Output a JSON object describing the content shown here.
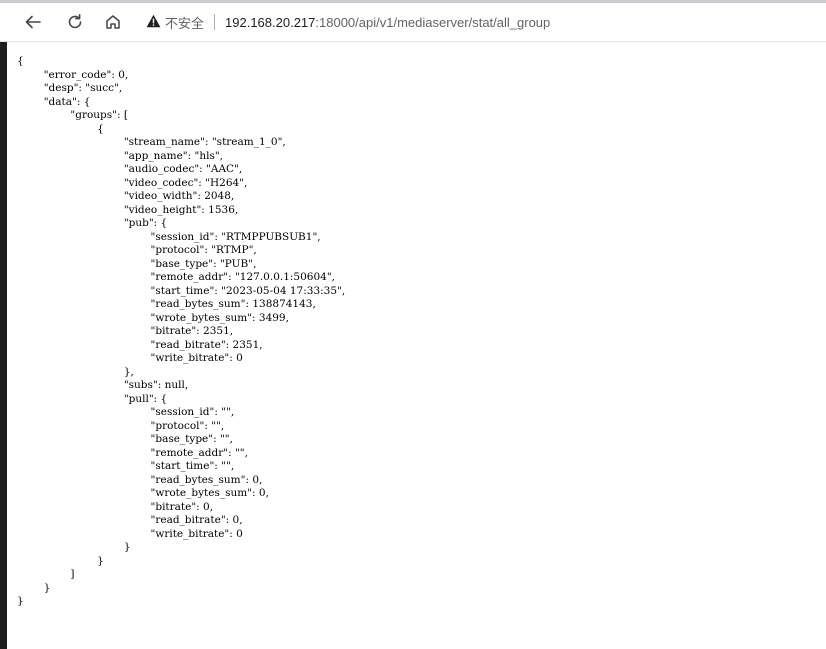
{
  "browser": {
    "security_label": "不安全",
    "url_host": "192.168.20.217",
    "url_rest": ":18000/api/v1/mediaserver/stat/all_group",
    "icons": {
      "back": "arrow-left-icon",
      "reload": "reload-icon",
      "home": "home-icon",
      "security": "warning-triangle-icon"
    }
  },
  "page": {
    "json_text": "{\n\t\"error_code\": 0,\n\t\"desp\": \"succ\",\n\t\"data\": {\n\t\t\"groups\": [\n\t\t\t{\n\t\t\t\t\"stream_name\": \"stream_1_0\",\n\t\t\t\t\"app_name\": \"hls\",\n\t\t\t\t\"audio_codec\": \"AAC\",\n\t\t\t\t\"video_codec\": \"H264\",\n\t\t\t\t\"video_width\": 2048,\n\t\t\t\t\"video_height\": 1536,\n\t\t\t\t\"pub\": {\n\t\t\t\t\t\"session_id\": \"RTMPPUBSUB1\",\n\t\t\t\t\t\"protocol\": \"RTMP\",\n\t\t\t\t\t\"base_type\": \"PUB\",\n\t\t\t\t\t\"remote_addr\": \"127.0.0.1:50604\",\n\t\t\t\t\t\"start_time\": \"2023-05-04 17:33:35\",\n\t\t\t\t\t\"read_bytes_sum\": 138874143,\n\t\t\t\t\t\"wrote_bytes_sum\": 3499,\n\t\t\t\t\t\"bitrate\": 2351,\n\t\t\t\t\t\"read_bitrate\": 2351,\n\t\t\t\t\t\"write_bitrate\": 0\n\t\t\t\t},\n\t\t\t\t\"subs\": null,\n\t\t\t\t\"pull\": {\n\t\t\t\t\t\"session_id\": \"\",\n\t\t\t\t\t\"protocol\": \"\",\n\t\t\t\t\t\"base_type\": \"\",\n\t\t\t\t\t\"remote_addr\": \"\",\n\t\t\t\t\t\"start_time\": \"\",\n\t\t\t\t\t\"read_bytes_sum\": 0,\n\t\t\t\t\t\"wrote_bytes_sum\": 0,\n\t\t\t\t\t\"bitrate\": 0,\n\t\t\t\t\t\"read_bitrate\": 0,\n\t\t\t\t\t\"write_bitrate\": 0\n\t\t\t\t}\n\t\t\t}\n\t\t]\n\t}\n}"
  }
}
